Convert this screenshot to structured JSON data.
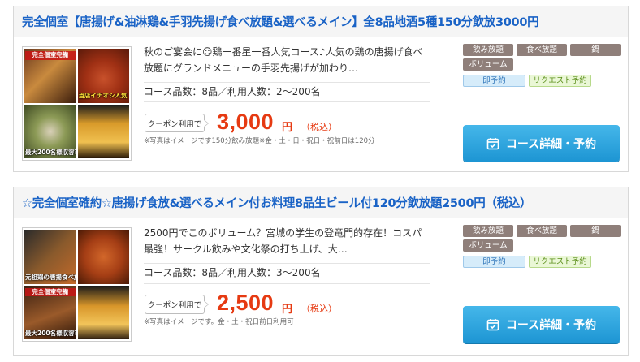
{
  "courses": [
    {
      "title": "完全個室【唐揚げ&油淋鶏&手羽先揚げ食べ放題&選べるメイン】全8品地酒5種150分飲放3000円",
      "photo_labels": [
        "完全個室完備",
        "当店イチオシ人気コース",
        "最大200名様収容可能"
      ],
      "description": "秋のご宴会に☺鶏一番星一番人気コース♪人気の鶏の唐揚げ食べ放題にグランドメニューの手羽先揚げが加わり…",
      "course_info": "コース品数：8品／利用人数：2～200名",
      "coupon_label": "クーポン利用で",
      "price": "3,000",
      "yen": "円",
      "tax_label": "（税込）",
      "note": "※写真はイメージです150分飲み放題※金・土・日・祝日・祝前日は120分",
      "tags": [
        "飲み放題",
        "食べ放題",
        "鍋",
        "ボリューム"
      ],
      "badges": [
        "即予約",
        "リクエスト予約"
      ],
      "cta_label": "コース詳細・予約"
    },
    {
      "title": "☆完全個室確約☆唐揚げ食放&選べるメイン付お料理8品生ビール付120分飲放題2500円（税込）",
      "photo_labels": [
        "元祖鶏の唐揚食べ放題",
        "完全個室完備",
        "最大200名様収容可能"
      ],
      "description": "2500円でこのボリューム？宮城の学生の登竜門的存在！コスパ最強！サークル飲みや文化祭の打ち上げ、大…",
      "course_info": "コース品数：8品／利用人数：3～200名",
      "coupon_label": "クーポン利用で",
      "price": "2,500",
      "yen": "円",
      "tax_label": "（税込）",
      "note": "※写真はイメージです。金・土・祝日前日利用可",
      "tags": [
        "飲み放題",
        "食べ放題",
        "鍋",
        "ボリューム"
      ],
      "badges": [
        "即予約",
        "リクエスト予約"
      ],
      "cta_label": "コース詳細・予約"
    }
  ],
  "icons": {
    "cta": "calendar-check-icon"
  },
  "colors": {
    "title": "#1a63c6",
    "price": "#e63a12",
    "cta": "#2aa3dd",
    "tag": "#8f7f7a"
  }
}
